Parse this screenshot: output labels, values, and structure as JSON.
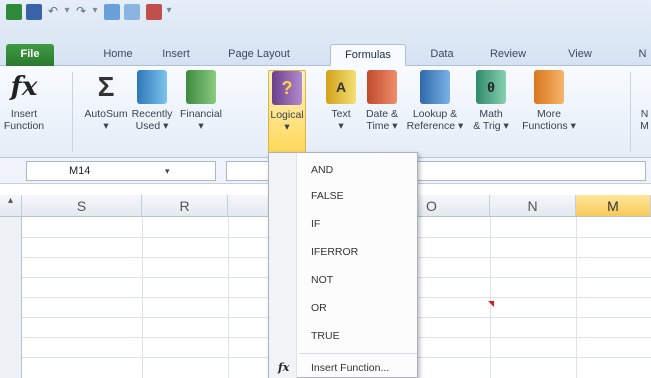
{
  "quick_access": {
    "icons": [
      "excel-icon",
      "save-icon",
      "undo-icon",
      "redo-icon",
      "chart-icon",
      "table-icon",
      "camera-icon",
      "customize-icon"
    ]
  },
  "tabs": {
    "file": "File",
    "home": "Home",
    "insert": "Insert",
    "page_layout": "Page Layout",
    "formulas": "Formulas",
    "data": "Data",
    "review": "Review",
    "view": "View",
    "overflow": "N"
  },
  "ribbon": {
    "insert_function": {
      "line1": "Insert",
      "line2": "Function"
    },
    "autosum": {
      "line1": "AutoSum",
      "line2": "▾"
    },
    "recently_used": {
      "line1": "Recently",
      "line2": "Used ▾"
    },
    "financial": {
      "line1": "Financial",
      "line2": "▾"
    },
    "logical": {
      "line1": "Logical",
      "line2": "▾"
    },
    "text": {
      "line1": "Text",
      "line2": "▾"
    },
    "date_time": {
      "line1": "Date &",
      "line2": "Time ▾"
    },
    "lookup_reference": {
      "line1": "Lookup &",
      "line2": "Reference ▾"
    },
    "math_trig": {
      "line1": "Math",
      "line2": "& Trig ▾"
    },
    "more_functions": {
      "line1": "More",
      "line2": "Functions ▾"
    },
    "overflow": {
      "line1": "N",
      "line2": "M"
    }
  },
  "formula_bar": {
    "name_box": "M14",
    "name_box_arrow": "▾"
  },
  "grid": {
    "columns": [
      "S",
      "R",
      "",
      "",
      "",
      "O",
      "N",
      "M"
    ]
  },
  "logical_menu": {
    "items": [
      "AND",
      "FALSE",
      "IF",
      "IFERROR",
      "NOT",
      "OR",
      "TRUE"
    ],
    "insert_function": "Insert Function...",
    "insert_function_icon": "fx"
  },
  "colors": {
    "file_tab": "#2a7a2e",
    "selected_button": "#ffd75a",
    "selected_column": "#f8c95a"
  }
}
